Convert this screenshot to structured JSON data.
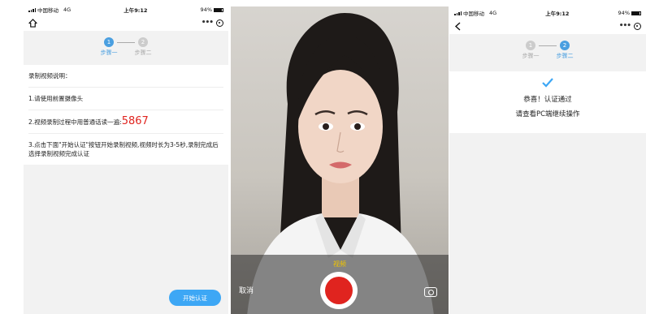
{
  "status": {
    "carrier": "中国移动",
    "network": "4G",
    "time": "上午9:12",
    "battery": "94%"
  },
  "steps": {
    "step1_num": "1",
    "step1_label": "步骤一",
    "step2_num": "2",
    "step2_label": "步骤二"
  },
  "instructions": {
    "heading": "录制视频说明：",
    "item1": "1.请使用前置摄像头",
    "item2_prefix": "2.视频录制过程中用普通话读一遍:",
    "item2_code": "5867",
    "item3": "3.点击下面\"开始认证\"按钮开始录制视频,视频时长为3-5秒,录制完成后选择录制视频完成认证"
  },
  "start_button": "开始认证",
  "camera": {
    "mode_label": "视频",
    "cancel_label": "取消"
  },
  "success": {
    "line1": "恭喜！认证通过",
    "line2": "请查看PC端继续操作"
  },
  "colors": {
    "accent": "#3da7f5",
    "record": "#e0241f",
    "code": "#e0241f",
    "mode": "#f0c400"
  },
  "icons": {
    "home": "home-icon",
    "back": "back-arrow-icon",
    "more": "more-icon",
    "close": "close-capsule-icon",
    "flip": "camera-flip-icon",
    "check": "checkmark-icon"
  }
}
